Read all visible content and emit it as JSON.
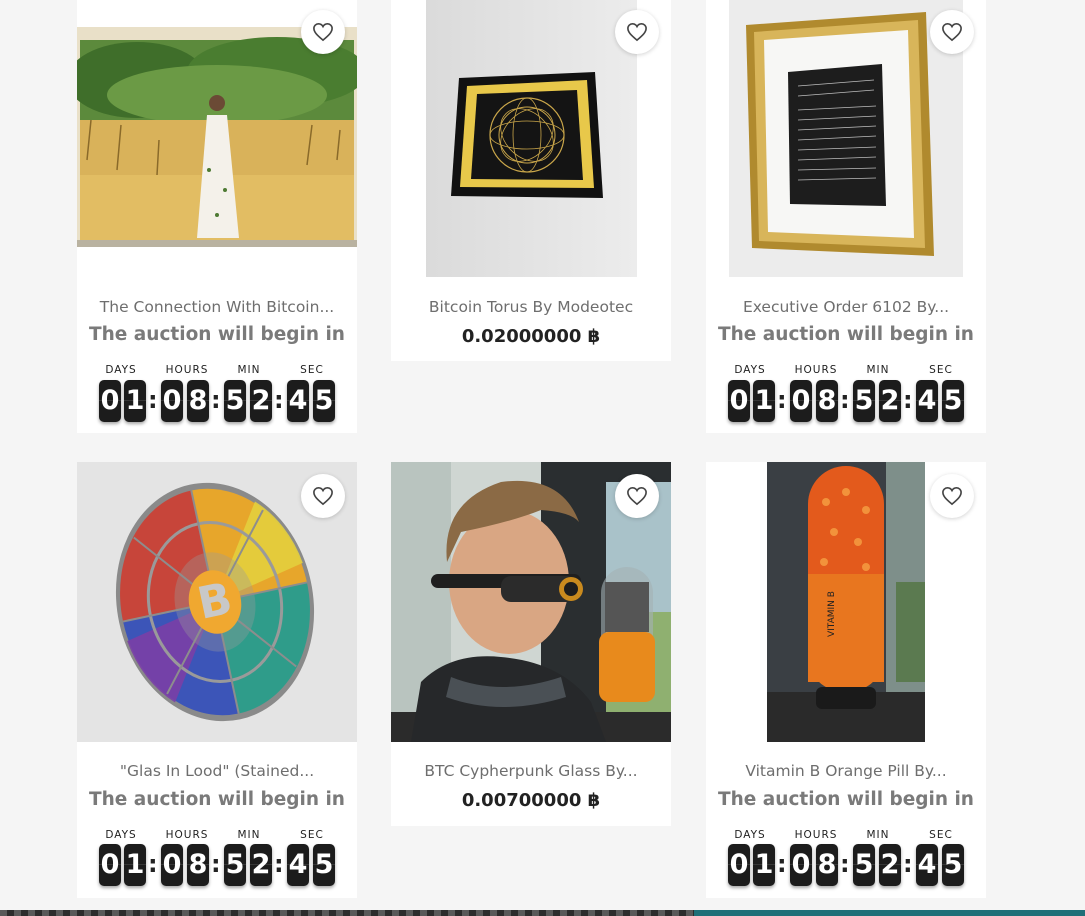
{
  "cards": [
    {
      "title": "The Connection With Bitcoin...",
      "status": "The auction will begin in"
    },
    {
      "title": "Bitcoin Torus By Modeotec",
      "price": "0.02000000 ฿"
    },
    {
      "title": "Executive Order 6102 By...",
      "status": "The auction will begin in"
    },
    {
      "title": "\"Glas In Lood\" (Stained...",
      "status": "The auction will begin in"
    },
    {
      "title": "BTC Cypherpunk Glass By...",
      "price": "0.00700000 ฿"
    },
    {
      "title": "Vitamin B Orange Pill By...",
      "status": "The auction will begin in"
    }
  ],
  "countdown": {
    "labels": {
      "days": "DAYS",
      "hours": "HOURS",
      "min": "MIN",
      "sec": "SEC"
    },
    "digits": [
      "0",
      "1",
      "0",
      "8",
      "5",
      "2",
      "4",
      "5"
    ],
    "separator": ":"
  },
  "icons": {
    "favorite": "heart-outline-icon"
  },
  "colors": {
    "digit_bg": "#1c1c1c",
    "title": "#6e6e6e",
    "status": "#7a7a7a",
    "price": "#222222",
    "page_bg": "#f5f5f5"
  }
}
